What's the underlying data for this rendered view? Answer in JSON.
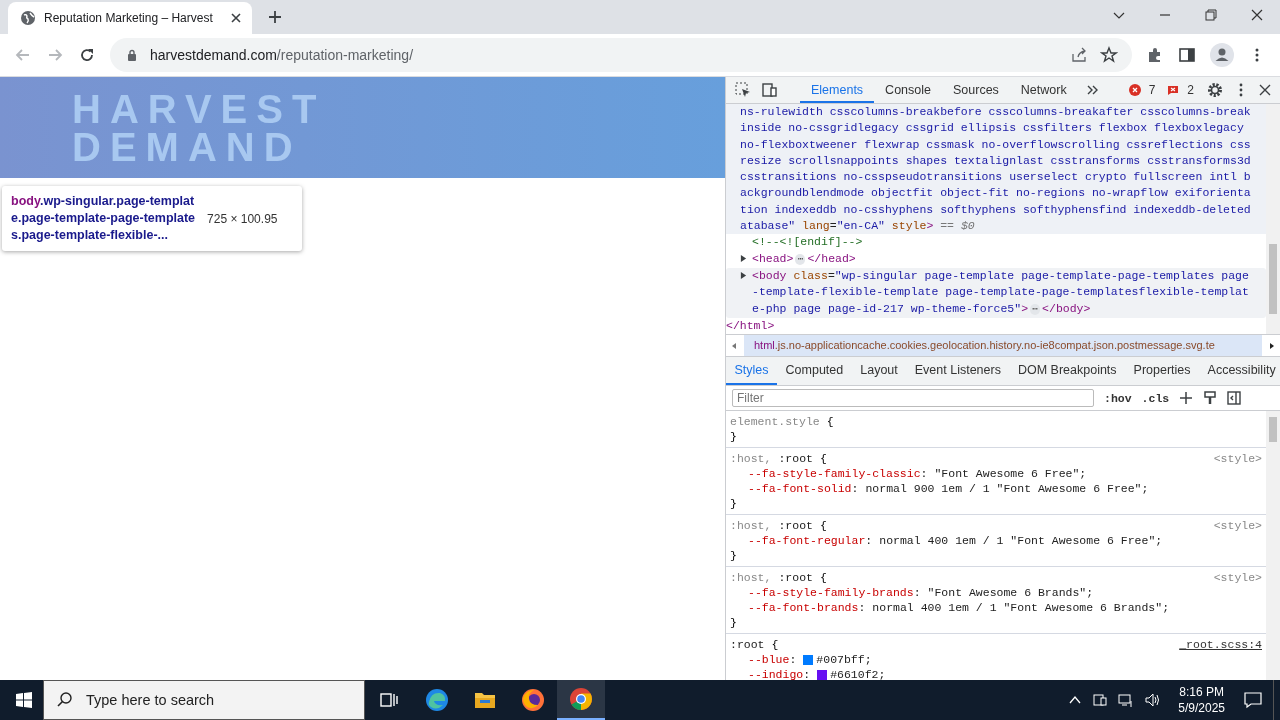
{
  "browser": {
    "tab": {
      "title": "Reputation Marketing – Harvest",
      "selected": true
    },
    "url": {
      "domain": "harvestdemand.com",
      "path": "/reputation-marketing/"
    }
  },
  "page": {
    "logo": [
      "HARVEST",
      "DEMAND"
    ],
    "tooltip": {
      "tag": "body",
      "lines": [
        ".wp-singular.page-templat",
        "e.page-template-page-template",
        "s.page-template-flexible-..."
      ],
      "size": "725 × 100.95"
    }
  },
  "devtools": {
    "tabs": [
      {
        "label": "Elements",
        "selected": true
      },
      {
        "label": "Console",
        "selected": false
      },
      {
        "label": "Sources",
        "selected": false
      },
      {
        "label": "Network",
        "selected": false
      }
    ],
    "errors": "7",
    "warnings": "2",
    "dom": {
      "selected": true,
      "html_tail": [
        [
          {
            "kind": "value",
            "text": "ns-rulewidth csscolumns-breakbefore csscolumns-breakafter csscolumns-break"
          }
        ],
        [
          {
            "kind": "value",
            "text": "inside no-cssgridlegacy cssgrid ellipsis cssfilters flexbox flexboxlegacy"
          }
        ],
        [
          {
            "kind": "value",
            "text": "no-flexboxtweener flexwrap cssmask no-overflowscrolling cssreflections css"
          }
        ],
        [
          {
            "kind": "value",
            "text": "resize scrollsnappoints shapes textalignlast csstransforms csstransforms3d"
          }
        ],
        [
          {
            "kind": "value",
            "text": "csstransitions no-csspseudotransitions userselect crypto fullscreen intl b"
          }
        ],
        [
          {
            "kind": "value",
            "text": "ackgroundblendmode objectfit object-fit no-regions no-wrapflow exiforienta"
          }
        ],
        [
          {
            "kind": "value",
            "text": "tion indexeddb no-csshyphens softhyphens softhyphensfind indexeddb-deleted"
          }
        ],
        [
          {
            "kind": "value",
            "text": "atabase\""
          },
          {
            "kind": "attr",
            "text": " lang"
          },
          {
            "kind": "plain",
            "text": "="
          },
          {
            "kind": "value",
            "text": "\"en-CA\""
          },
          {
            "kind": "attr",
            "text": " style"
          },
          {
            "kind": "tag",
            "text": ">"
          },
          {
            "kind": "marker",
            "text": " == $0"
          }
        ]
      ],
      "children": [
        {
          "expandable": false,
          "highlighted": false,
          "lines": [
            [
              {
                "kind": "comment",
                "text": "<!--<![endif]-->"
              }
            ]
          ]
        },
        {
          "expandable": true,
          "highlighted": false,
          "lines": [
            [
              {
                "kind": "tag",
                "text": "<head>"
              },
              {
                "kind": "ellipsis",
                "text": "⋯"
              },
              {
                "kind": "tag",
                "text": "</head>"
              }
            ]
          ]
        },
        {
          "expandable": true,
          "highlighted": true,
          "lines": [
            [
              {
                "kind": "tag",
                "text": "<body"
              },
              {
                "kind": "attr",
                "text": " class"
              },
              {
                "kind": "plain",
                "text": "="
              },
              {
                "kind": "value",
                "text": "\"wp-singular page-template page-template-page-templates page"
              }
            ],
            [
              {
                "kind": "value",
                "text": "-template-flexible-template page-template-page-templatesflexible-templat"
              }
            ],
            [
              {
                "kind": "value",
                "text": "e-php page page-id-217 wp-theme-force5\""
              },
              {
                "kind": "tag",
                "text": ">"
              },
              {
                "kind": "ellipsis",
                "text": "⋯"
              },
              {
                "kind": "tag",
                "text": "</body>"
              }
            ]
          ]
        }
      ],
      "close": [
        {
          "kind": "tag",
          "text": "</html>"
        }
      ]
    },
    "breadcrumb": {
      "tag": "html",
      "classes": ".js.no-applicationcache.cookies.geolocation.history.no-ie8compat.json.postmessage.svg.te"
    },
    "style_tabs": [
      {
        "label": "Styles",
        "selected": true
      },
      {
        "label": "Computed",
        "selected": false
      },
      {
        "label": "Layout",
        "selected": false
      },
      {
        "label": "Event Listeners",
        "selected": false
      },
      {
        "label": "DOM Breakpoints",
        "selected": false
      },
      {
        "label": "Properties",
        "selected": false
      },
      {
        "label": "Accessibility",
        "selected": false
      }
    ],
    "filter": {
      "placeholder": "Filter"
    },
    "hov": ":hov",
    "cls": ".cls",
    "rules": [
      {
        "selector_dim": "element.style",
        "open": "{",
        "close": "}"
      },
      {
        "selector_dim": ":host,",
        "selector": ":root",
        "open": "{",
        "close": "}",
        "source": "<style>",
        "props": [
          {
            "name": "--fa-style-family-classic",
            "sep": ":",
            "value": "\"Font Awesome 6 Free\";"
          },
          {
            "name": "--fa-font-solid",
            "sep": ":",
            "value": "normal 900 1em / 1 \"Font Awesome 6 Free\";"
          }
        ]
      },
      {
        "selector_dim": ":host,",
        "selector": ":root",
        "open": "{",
        "close": "}",
        "source": "<style>",
        "props": [
          {
            "name": "--fa-font-regular",
            "sep": ":",
            "value": "normal 400 1em / 1 \"Font Awesome 6 Free\";"
          }
        ]
      },
      {
        "selector_dim": ":host,",
        "selector": ":root",
        "open": "{",
        "close": "}",
        "source": "<style>",
        "props": [
          {
            "name": "--fa-style-family-brands",
            "sep": ":",
            "value": "\"Font Awesome 6 Brands\";"
          },
          {
            "name": "--fa-font-brands",
            "sep": ":",
            "value": "normal 400 1em / 1 \"Font Awesome 6 Brands\";"
          }
        ]
      },
      {
        "selector": ":root",
        "open": "{",
        "source_link": "_root.scss:4",
        "props": [
          {
            "name": "--blue",
            "sep": ":",
            "value": "#007bff;",
            "color": "#007bff"
          },
          {
            "name": "--indigo",
            "sep": ":",
            "value": "#6610f2;",
            "color": "#6610f2"
          }
        ]
      }
    ]
  },
  "taskbar": {
    "search": {
      "placeholder": "Type here to search"
    },
    "time": "8:16 PM",
    "date": "5/9/2025"
  }
}
